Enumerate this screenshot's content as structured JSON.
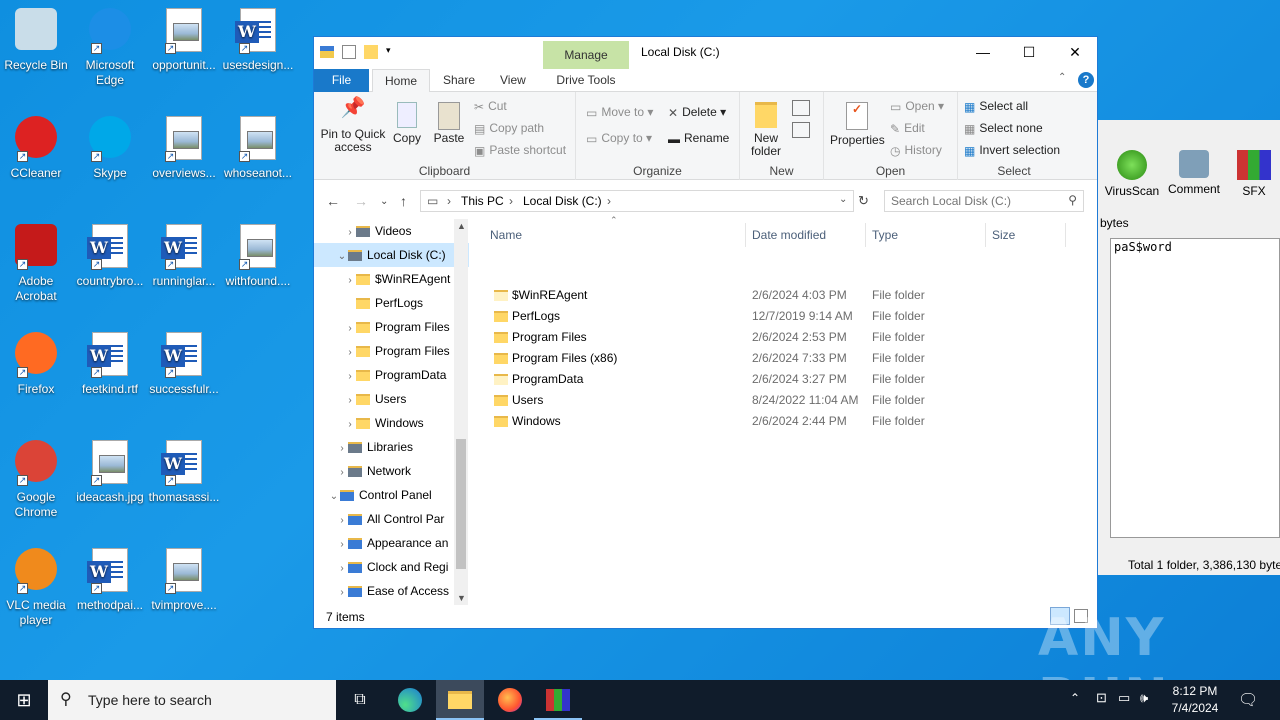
{
  "desktop": {
    "icons": [
      {
        "label": "Recycle Bin",
        "icon": "recycle-bin-icon"
      },
      {
        "label": "Microsoft Edge",
        "icon": "edge-icon"
      },
      {
        "label": "opportunit...",
        "icon": "image-file-icon"
      },
      {
        "label": "usesdesign...",
        "icon": "word-file-icon"
      },
      {
        "label": "CCleaner",
        "icon": "ccleaner-icon"
      },
      {
        "label": "Skype",
        "icon": "skype-icon"
      },
      {
        "label": "overviews...",
        "icon": "image-file-icon"
      },
      {
        "label": "whoseanot...",
        "icon": "image-file-icon"
      },
      {
        "label": "Adobe Acrobat",
        "icon": "acrobat-icon"
      },
      {
        "label": "countrybro...",
        "icon": "word-file-icon"
      },
      {
        "label": "runninglar...",
        "icon": "word-file-icon"
      },
      {
        "label": "withfound....",
        "icon": "image-file-icon"
      },
      {
        "label": "Firefox",
        "icon": "firefox-icon"
      },
      {
        "label": "feetkind.rtf",
        "icon": "word-file-icon"
      },
      {
        "label": "successfulr...",
        "icon": "word-file-icon"
      },
      {
        "label": "Google Chrome",
        "icon": "chrome-icon"
      },
      {
        "label": "ideacash.jpg",
        "icon": "image-file-icon"
      },
      {
        "label": "thomasassi...",
        "icon": "word-file-icon"
      },
      {
        "label": "VLC media player",
        "icon": "vlc-icon"
      },
      {
        "label": "methodpai...",
        "icon": "word-file-icon"
      },
      {
        "label": "tvimprove....",
        "icon": "image-file-icon"
      }
    ]
  },
  "explorer": {
    "title": "Local Disk (C:)",
    "manage_tab": "Manage",
    "tabs": {
      "file": "File",
      "home": "Home",
      "share": "Share",
      "view": "View",
      "drive_tools": "Drive Tools"
    },
    "ribbon": {
      "clipboard": {
        "pin": "Pin to Quick access",
        "copy": "Copy",
        "paste": "Paste",
        "cut": "Cut",
        "copy_path": "Copy path",
        "paste_shortcut": "Paste shortcut",
        "label": "Clipboard"
      },
      "organize": {
        "move_to": "Move to",
        "copy_to": "Copy to",
        "delete": "Delete",
        "rename": "Rename",
        "label": "Organize"
      },
      "new": {
        "new_folder": "New folder",
        "label": "New"
      },
      "open": {
        "properties": "Properties",
        "open": "Open",
        "edit": "Edit",
        "history": "History",
        "label": "Open"
      },
      "select": {
        "select_all": "Select all",
        "select_none": "Select none",
        "invert": "Invert selection",
        "label": "Select"
      }
    },
    "address": {
      "this_pc": "This PC",
      "local_disk": "Local Disk (C:)",
      "search_placeholder": "Search Local Disk (C:)"
    },
    "nav": [
      {
        "label": "Videos",
        "chev": "›"
      },
      {
        "label": "Local Disk (C:)",
        "chev": "⌄"
      },
      {
        "label": "$WinREAgent",
        "chev": "›"
      },
      {
        "label": "PerfLogs",
        "chev": ""
      },
      {
        "label": "Program Files",
        "chev": "›"
      },
      {
        "label": "Program Files",
        "chev": "›"
      },
      {
        "label": "ProgramData",
        "chev": "›"
      },
      {
        "label": "Users",
        "chev": "›"
      },
      {
        "label": "Windows",
        "chev": "›"
      },
      {
        "label": "Libraries",
        "chev": "›"
      },
      {
        "label": "Network",
        "chev": "›"
      },
      {
        "label": "Control Panel",
        "chev": "⌄"
      },
      {
        "label": "All Control Par",
        "chev": "›"
      },
      {
        "label": "Appearance an",
        "chev": "›"
      },
      {
        "label": "Clock and Regi",
        "chev": "›"
      },
      {
        "label": "Ease of Access",
        "chev": "›"
      }
    ],
    "columns": {
      "name": "Name",
      "date": "Date modified",
      "type": "Type",
      "size": "Size"
    },
    "files": [
      {
        "name": "$WinREAgent",
        "date": "2/6/2024 4:03 PM",
        "type": "File folder"
      },
      {
        "name": "PerfLogs",
        "date": "12/7/2019 9:14 AM",
        "type": "File folder"
      },
      {
        "name": "Program Files",
        "date": "2/6/2024 2:53 PM",
        "type": "File folder"
      },
      {
        "name": "Program Files (x86)",
        "date": "2/6/2024 7:33 PM",
        "type": "File folder"
      },
      {
        "name": "ProgramData",
        "date": "2/6/2024 3:27 PM",
        "type": "File folder"
      },
      {
        "name": "Users",
        "date": "8/24/2022 11:04 AM",
        "type": "File folder"
      },
      {
        "name": "Windows",
        "date": "2/6/2024 2:44 PM",
        "type": "File folder"
      }
    ],
    "status": "7 items"
  },
  "winrar": {
    "virusscan": "VirusScan",
    "comment": "Comment",
    "sfx": "SFX",
    "bytes": "bytes",
    "password_text": "paS$word",
    "status": "Total 1 folder, 3,386,130 byte"
  },
  "taskbar": {
    "search_placeholder": "Type here to search",
    "time": "8:12 PM",
    "date": "7/4/2024"
  },
  "watermark": "ANY RUN"
}
